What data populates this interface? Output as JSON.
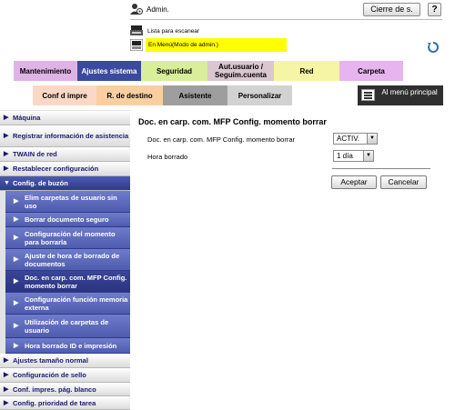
{
  "header": {
    "user_label": "Admin.",
    "logout_label": "Cierre de s.",
    "help_label": "?",
    "scan_label": "Lista para escanear",
    "mode_label": "En Menú(Modo de admin.)"
  },
  "colors": {
    "selected_tab": "#3b4a9c",
    "sidebar_open": "#2e3a8c",
    "mode_bar": "#ffff00"
  },
  "tabs_row1": [
    {
      "label": "Mantenimiento",
      "color": "#dfb3e6"
    },
    {
      "label": "Ajustes sistema",
      "color": "#3b4a9c",
      "selected": true
    },
    {
      "label": "Seguridad",
      "color": "#d9ee9a"
    },
    {
      "label": "Aut.usuario / Seguim.cuenta",
      "color": "#d9c6cf"
    },
    {
      "label": "Red",
      "color": "#f6f5a5"
    },
    {
      "label": "Carpeta",
      "color": "#e7b4ef"
    }
  ],
  "tabs_row2": [
    {
      "label": "Conf d impre",
      "color": "#fbd8c6"
    },
    {
      "label": "R. de destino",
      "color": "#f9cfa2"
    },
    {
      "label": "Asistente",
      "color": "#9e9e9e"
    },
    {
      "label": "Personalizar",
      "color": "#d2d2d2"
    }
  ],
  "main_menu": {
    "label": "Al menú principal"
  },
  "sidebar": {
    "items": [
      {
        "label": "Máquina"
      },
      {
        "label": "Registrar información de asistencia"
      },
      {
        "label": "TWAIN de red"
      },
      {
        "label": "Restablecer configuración"
      },
      {
        "label": "Config. de buzón"
      },
      {
        "label": "Ajustes tamaño normal"
      },
      {
        "label": "Configuración de sello"
      },
      {
        "label": "Conf. impres. pág. blanco"
      },
      {
        "label": "Config. prioridad de tarea"
      }
    ],
    "subitems": [
      {
        "label": "Elim carpetas de usuario sin uso"
      },
      {
        "label": "Borrar documento seguro"
      },
      {
        "label": "Configuración del momento para borrarla"
      },
      {
        "label": "Ajuste de hora de borrado de documentos"
      },
      {
        "label": "Doc. en carp. com. MFP Config. momento borrar"
      },
      {
        "label": "Configuración función memoria externa"
      },
      {
        "label": "Utilización de carpetas de usuario"
      },
      {
        "label": "Hora borrado ID e impresión"
      }
    ]
  },
  "main": {
    "title": "Doc. en carp. com. MFP Config. momento borrar",
    "field1_label": "Doc. en carp. com. MFP Config. momento borrar",
    "field1_value": "ACTIV.",
    "field2_label": "Hora borrado",
    "field2_value": "1 día",
    "ok_label": "Aceptar",
    "cancel_label": "Cancelar"
  }
}
